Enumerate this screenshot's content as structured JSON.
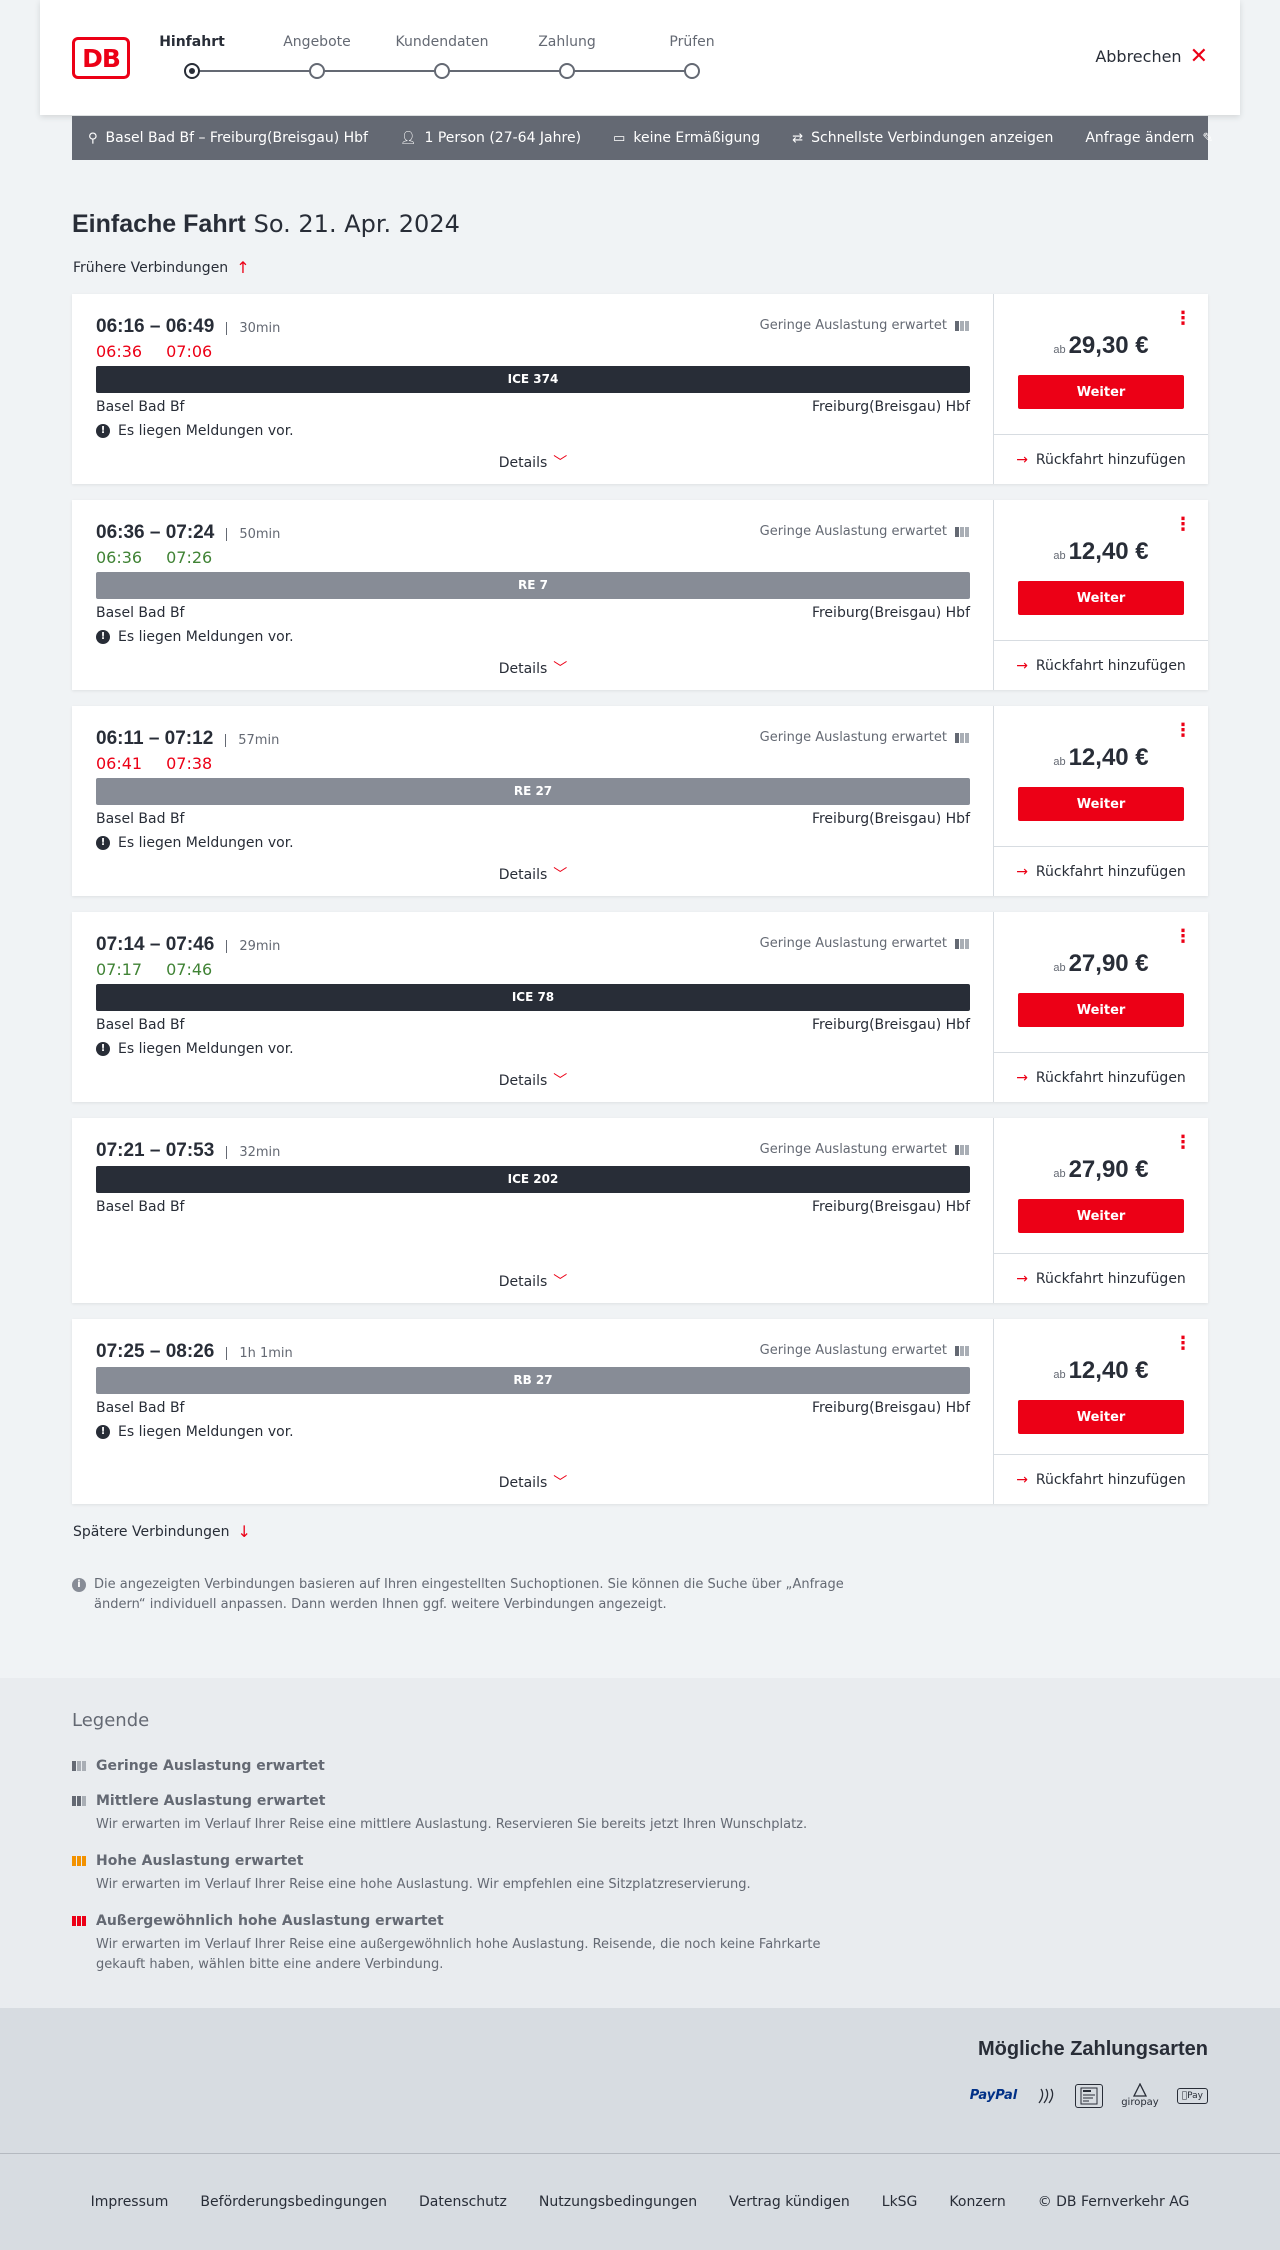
{
  "header": {
    "steps": [
      "Hinfahrt",
      "Angebote",
      "Kundendaten",
      "Zahlung",
      "Prüfen"
    ],
    "cancel_label": "Abbrechen"
  },
  "search": {
    "route": "Basel Bad Bf – Freiburg(Breisgau) Hbf",
    "persons": "1 Person (27-64 Jahre)",
    "discount": "keine Ermäßigung",
    "fastest": "Schnellste Verbindungen anzeigen",
    "change": "Anfrage ändern"
  },
  "page": {
    "title": "Einfache Fahrt",
    "date": "So. 21. Apr. 2024",
    "earlier": "Frühere Verbindungen",
    "later": "Spätere Verbindungen",
    "info": "Die angezeigten Verbindungen basieren auf Ihren eingestellten Suchoptionen. Sie können die Suche über „Anfrage ändern“ individuell anpassen. Dann werden Ihnen ggf. weitere Verbindungen angezeigt."
  },
  "common": {
    "utilization": "Geringe Auslastung erwartet",
    "from": "Basel Bad Bf",
    "to": "Freiburg(Breisgau) Hbf",
    "message": "Es liegen Meldungen vor.",
    "details": "Details",
    "price_prefix": "ab",
    "weiter": "Weiter",
    "return": "Rückfahrt hinzufügen"
  },
  "connections": [
    {
      "times": "06:16 – 06:49",
      "duration": "30min",
      "rt_dep": "06:36",
      "rt_arr": "07:06",
      "rt_status": "delayed",
      "train": "ICE 374",
      "train_style": "dark",
      "price": "29,30 €"
    },
    {
      "times": "06:36 – 07:24",
      "duration": "50min",
      "rt_dep": "06:36",
      "rt_arr": "07:26",
      "rt_status": "ontime",
      "train": "RE 7",
      "train_style": "grey",
      "price": "12,40 €"
    },
    {
      "times": "06:11 – 07:12",
      "duration": "57min",
      "rt_dep": "06:41",
      "rt_arr": "07:38",
      "rt_status": "delayed",
      "train": "RE 27",
      "train_style": "grey",
      "price": "12,40 €"
    },
    {
      "times": "07:14 – 07:46",
      "duration": "29min",
      "rt_dep": "07:17",
      "rt_arr": "07:46",
      "rt_status": "ontime",
      "train": "ICE 78",
      "train_style": "dark",
      "price": "27,90 €"
    },
    {
      "times": "07:21 – 07:53",
      "duration": "32min",
      "rt_dep": "",
      "rt_arr": "",
      "rt_status": "none",
      "train": "ICE 202",
      "train_style": "dark",
      "price": "27,90 €"
    },
    {
      "times": "07:25 – 08:26",
      "duration": "1h 1min",
      "rt_dep": "",
      "rt_arr": "",
      "rt_status": "none",
      "train": "RB 27",
      "train_style": "grey",
      "price": "12,40 €"
    }
  ],
  "legend": {
    "title": "Legende",
    "items": [
      {
        "title": "Geringe Auslastung erwartet",
        "desc": "",
        "color": "#646973",
        "filled": 1
      },
      {
        "title": "Mittlere Auslastung erwartet",
        "desc": "Wir erwarten im Verlauf Ihrer Reise eine mittlere Auslastung. Reservieren Sie bereits jetzt Ihren Wunschplatz.",
        "color": "#646973",
        "filled": 2
      },
      {
        "title": "Hohe Auslastung erwartet",
        "desc": "Wir erwarten im Verlauf Ihrer Reise eine hohe Auslastung. Wir empfehlen eine Sitzplatzreservierung.",
        "color": "#f39200",
        "filled": 3
      },
      {
        "title": "Außergewöhnlich hohe Auslastung erwartet",
        "desc": "Wir erwarten im Verlauf Ihrer Reise eine außergewöhnlich hohe Auslastung. Reisende, die noch keine Fahrkarte gekauft haben, wählen bitte eine andere Verbindung.",
        "color": "#ec0016",
        "filled": 3
      }
    ]
  },
  "payment": {
    "title": "Mögliche Zahlungsarten",
    "methods": [
      "PayPal",
      "giropay",
      "Pay"
    ]
  },
  "footer": {
    "links": [
      "Impressum",
      "Beförderungsbedingungen",
      "Datenschutz",
      "Nutzungsbedingungen",
      "Vertrag kündigen",
      "LkSG",
      "Konzern",
      "© DB Fernverkehr AG"
    ]
  },
  "colors": {
    "accent": "#ec0016",
    "ontime": "#408335",
    "dark": "#282d37",
    "grey": "#878c96"
  }
}
